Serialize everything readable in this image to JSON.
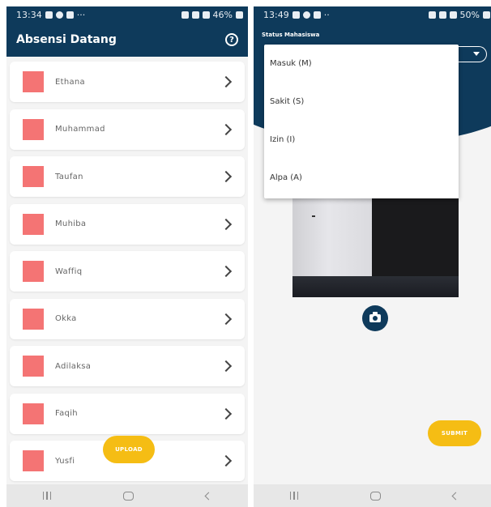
{
  "left": {
    "statusbar": {
      "time": "13:34",
      "dots": "···",
      "battery": "46%"
    },
    "appbar": {
      "title": "Absensi Datang",
      "help_glyph": "?"
    },
    "students": [
      {
        "name": "Ethana"
      },
      {
        "name": "Muhammad"
      },
      {
        "name": "Taufan"
      },
      {
        "name": "Muhiba"
      },
      {
        "name": "Waffiq"
      },
      {
        "name": "Okka"
      },
      {
        "name": "Adilaksa"
      },
      {
        "name": "Faqih"
      },
      {
        "name": "Yusfi"
      }
    ],
    "upload_label": "UPLOAD"
  },
  "right": {
    "statusbar": {
      "time": "13:49",
      "dots": "··",
      "battery": "50%"
    },
    "status_label": "Status Mahasiswa",
    "options": [
      {
        "label": "Masuk  (M)"
      },
      {
        "label": "Sakit  (S)"
      },
      {
        "label": "Izin  (I)"
      },
      {
        "label": "Alpa  (A)"
      }
    ],
    "submit_label": "SUBMIT"
  },
  "colors": {
    "primary": "#0e3a5b",
    "accent": "#f5bd14",
    "swatch": "#f47474",
    "background": "#f4f4f4"
  }
}
